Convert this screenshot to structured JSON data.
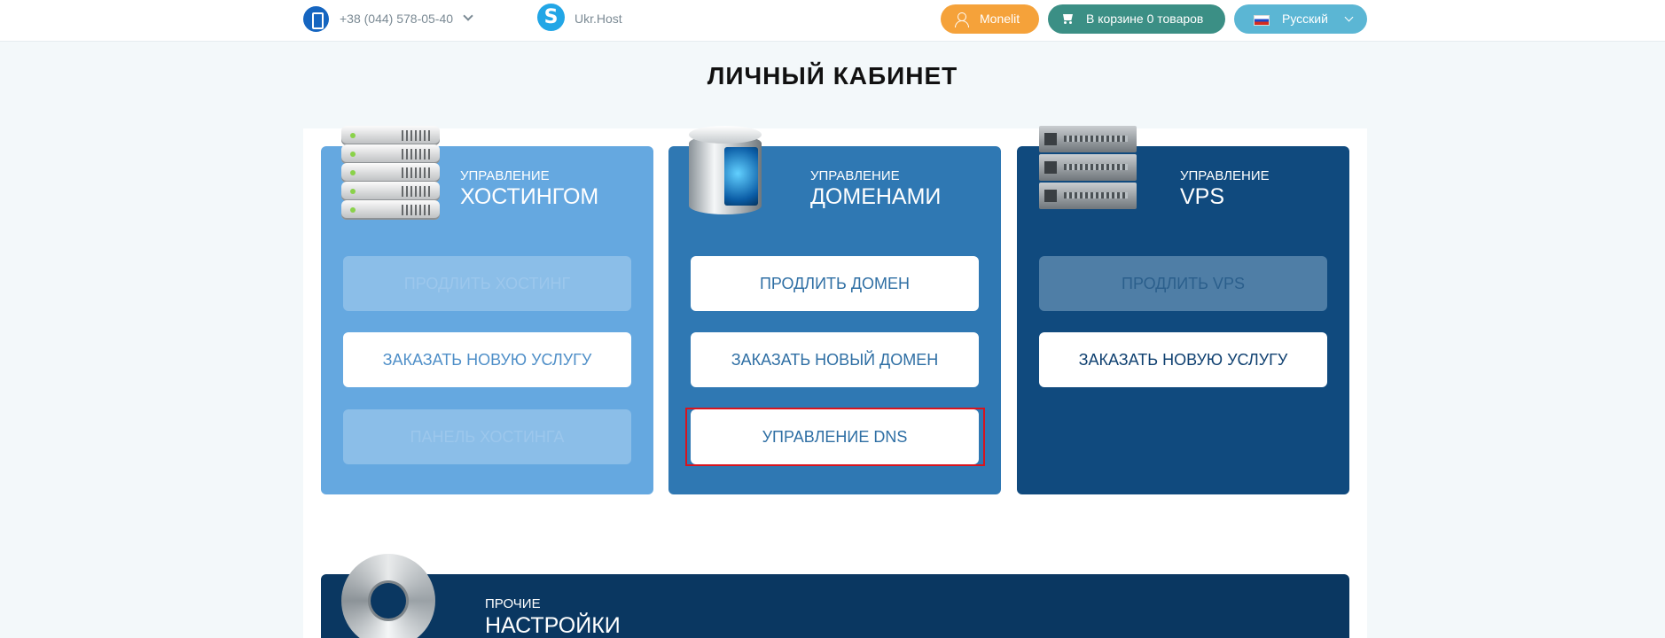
{
  "header": {
    "phone": "+38 (044) 578-05-40",
    "skype": "Ukr.Host",
    "user_label": "Monelit",
    "cart_label": "В корзине 0 товаров",
    "language_label": "Русский",
    "colors": {
      "user": "#f5a23a",
      "cart": "#3b8f85",
      "language": "#5bb6d4",
      "phone_icon": "#1565c0",
      "skype_icon": "#22a6e6"
    }
  },
  "page_title": "ЛИЧНЫЙ КАБИНЕТ",
  "cards": {
    "hosting": {
      "subtitle": "УПРАВЛЕНИЕ",
      "title": "ХОСТИНГОМ",
      "icon": "server-stack-icon",
      "buttons": [
        "ПРОДЛИТЬ ХОСТИНГ",
        "ЗАКАЗАТЬ НОВУЮ УСЛУГУ",
        "ПАНЕЛЬ ХОСТИНГА"
      ]
    },
    "domains": {
      "subtitle": "УПРАВЛЕНИЕ",
      "title": "ДОМЕНАМИ",
      "icon": "database-globe-icon",
      "buttons": [
        "ПРОДЛИТЬ ДОМЕН",
        "ЗАКАЗАТЬ НОВЫЙ ДОМЕН",
        "УПРАВЛЕНИЕ DNS"
      ]
    },
    "vps": {
      "subtitle": "УПРАВЛЕНИЕ",
      "title": "VPS",
      "icon": "server-rack-icon",
      "buttons": [
        "ПРОДЛИТЬ VPS",
        "ЗАКАЗАТЬ НОВУЮ УСЛУГУ"
      ]
    },
    "settings": {
      "subtitle": "ПРОЧИЕ",
      "title": "НАСТРОЙКИ",
      "icon": "gear-icon"
    },
    "colors": {
      "hosting": "#65a8e0",
      "domains": "#2f78b3",
      "vps": "#104a7e",
      "settings": "#0a3761"
    }
  }
}
